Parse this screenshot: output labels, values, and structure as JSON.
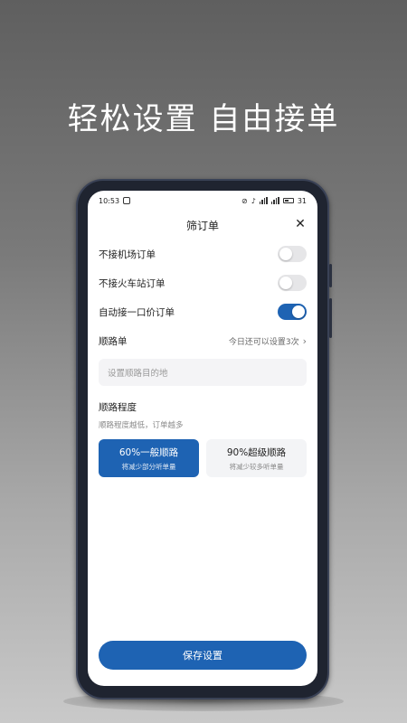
{
  "headline": "轻松设置 自由接单",
  "status": {
    "time": "10:53",
    "battery": "31"
  },
  "sheet": {
    "title": "筛订单",
    "close_label": "✕"
  },
  "toggles": [
    {
      "label": "不接机场订单",
      "on": false
    },
    {
      "label": "不接火车站订单",
      "on": false
    },
    {
      "label": "自动接一口价订单",
      "on": true
    }
  ],
  "route_order": {
    "label": "顺路单",
    "hint": "今日还可以设置3次",
    "chevron": "›"
  },
  "destination": {
    "placeholder": "设置顺路目的地"
  },
  "route_degree": {
    "title": "顺路程度",
    "subtitle": "顺路程度越低，订单越多",
    "options": [
      {
        "title": "60%一般顺路",
        "sub": "将减少部分听单量",
        "selected": true
      },
      {
        "title": "90%超级顺路",
        "sub": "将减少较多听单量",
        "selected": false
      }
    ]
  },
  "save_label": "保存设置",
  "colors": {
    "accent": "#1e63b3"
  }
}
